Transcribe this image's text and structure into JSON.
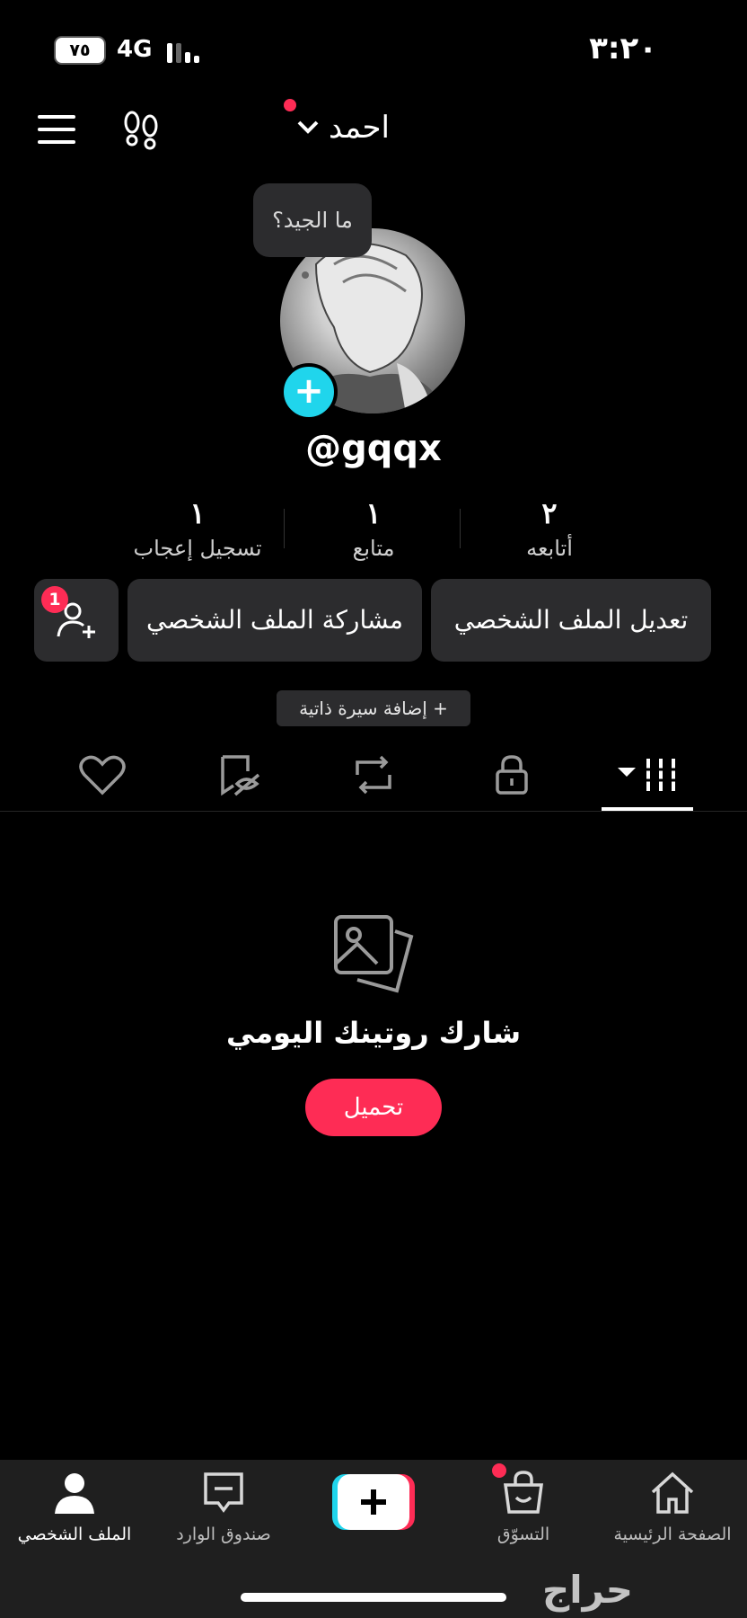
{
  "status_bar": {
    "battery": "٧٥",
    "network": "4G",
    "time": "٣:٢٠"
  },
  "header": {
    "username": "احمد"
  },
  "profile": {
    "bubble_text": "ما الجيد؟",
    "handle": "@gqqx",
    "stats": [
      {
        "value": "٢",
        "label": "أتابعه"
      },
      {
        "value": "١",
        "label": "متابع"
      },
      {
        "value": "١",
        "label": "تسجيل إعجاب"
      }
    ],
    "edit_profile": "تعديل الملف الشخصي",
    "share_profile": "مشاركة الملف الشخصي",
    "friend_badge": "1",
    "add_bio": "+ إضافة سيرة ذاتية"
  },
  "empty_state": {
    "title": "شارك روتينك اليومي",
    "upload": "تحميل"
  },
  "bottom_nav": {
    "home": "الصفحة الرئيسية",
    "shop": "التسوّق",
    "inbox": "صندوق الوارد",
    "profile": "الملف الشخصي"
  },
  "watermark": "حراج",
  "colors": {
    "accent_red": "#fe2c55",
    "accent_cyan": "#20d5ec",
    "surface": "#2c2c2e"
  }
}
